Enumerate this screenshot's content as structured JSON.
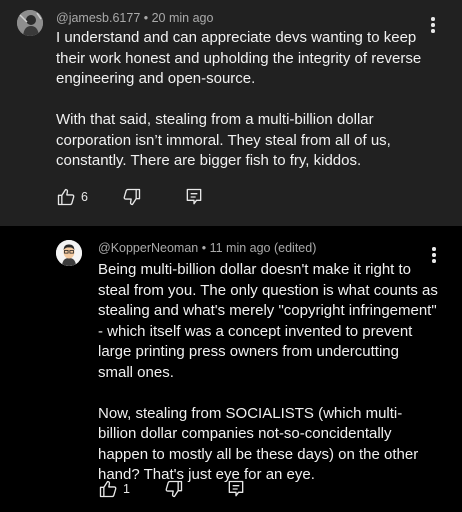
{
  "comments": [
    {
      "author": "@jamesb.6177",
      "time": "20 min ago",
      "paragraphs": [
        "I understand and can appreciate devs wanting to keep their work honest and upholding the integrity of reverse engineering and open-source.",
        "With that said, stealing from a multi-billion dollar corporation isn’t immoral. They steal from all of us, constantly. There are bigger fish to fry, kiddos."
      ],
      "likes": "6",
      "icons": {
        "like": "thumbs-up-icon",
        "dislike": "thumbs-down-icon",
        "reply": "reply-icon",
        "menu": "kebab-menu-icon"
      }
    },
    {
      "author": "@KopperNeoman",
      "time": "11 min ago (edited)",
      "paragraphs": [
        "Being multi-billion dollar doesn't make it right to steal from you. The only question is what counts as stealing and what's merely \"copyright infringement\" - which itself was a concept invented to prevent large printing press owners from undercutting small ones.",
        "Now, stealing from SOCIALISTS (which multi-billion dollar companies not-so-concidentally happen to mostly all be these days) on the other hand? That's just eye for an eye."
      ],
      "likes": "1",
      "icons": {
        "like": "thumbs-up-icon",
        "dislike": "thumbs-down-icon",
        "reply": "reply-icon",
        "menu": "kebab-menu-icon"
      }
    }
  ],
  "separator": " • ",
  "colors": {
    "top_comment_bg": "#212121",
    "reply_bg": "#000000",
    "text": "#f1f1f1",
    "meta": "#aaaaaa"
  }
}
